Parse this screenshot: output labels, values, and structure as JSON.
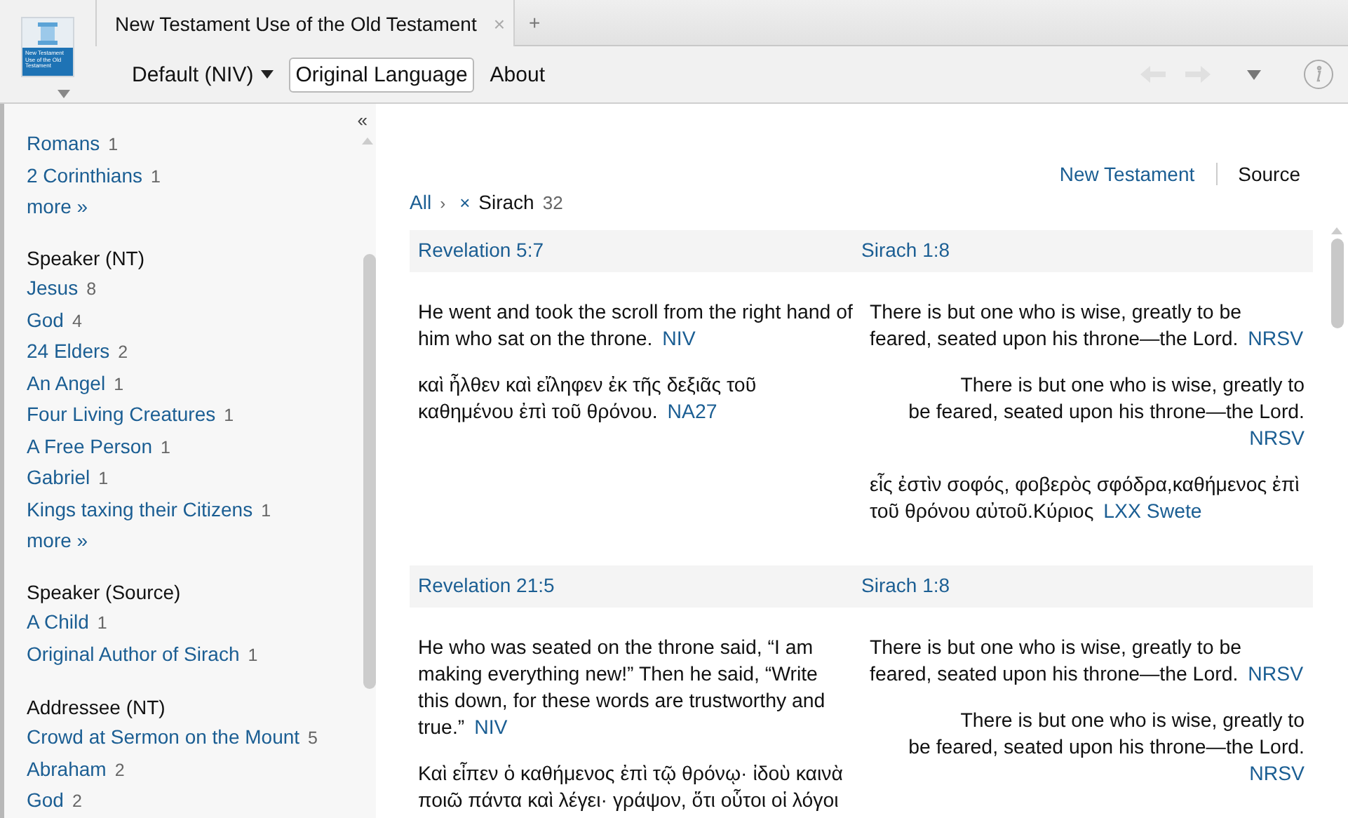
{
  "tab": {
    "title": "New Testament Use of the Old Testament",
    "close": "×",
    "add": "+"
  },
  "book_cover": {
    "title": "New Testament Use of the Old Testament"
  },
  "toolbar": {
    "items": [
      {
        "kind": "dropdown",
        "label": "Default (NIV)"
      },
      {
        "kind": "button",
        "label": "Original Language"
      },
      {
        "kind": "link",
        "label": "About"
      }
    ],
    "back_disabled": true,
    "forward_disabled": true
  },
  "sidebar": {
    "collapse": "«",
    "groups": [
      {
        "items": [
          {
            "label": "Romans",
            "count": "1"
          },
          {
            "label": "2 Corinthians",
            "count": "1"
          }
        ],
        "more": "more »"
      },
      {
        "heading": "Speaker (NT)",
        "items": [
          {
            "label": "Jesus",
            "count": "8"
          },
          {
            "label": "God",
            "count": "4"
          },
          {
            "label": "24 Elders",
            "count": "2"
          },
          {
            "label": "An Angel",
            "count": "1"
          },
          {
            "label": "Four Living Creatures",
            "count": "1"
          },
          {
            "label": "A Free Person",
            "count": "1"
          },
          {
            "label": "Gabriel",
            "count": "1"
          },
          {
            "label": "Kings taxing their Citizens",
            "count": "1"
          }
        ],
        "more": "more »"
      },
      {
        "heading": "Speaker (Source)",
        "items": [
          {
            "label": "A Child",
            "count": "1"
          },
          {
            "label": "Original Author of Sirach",
            "count": "1"
          }
        ]
      },
      {
        "heading": "Addressee (NT)",
        "items": [
          {
            "label": "Crowd at Sermon on the Mount",
            "count": "5"
          },
          {
            "label": "Abraham",
            "count": "2"
          },
          {
            "label": "God",
            "count": "2"
          }
        ]
      }
    ]
  },
  "main": {
    "view_toggle": [
      {
        "label": "New Testament",
        "selected": false
      },
      {
        "label": "Source",
        "selected": true
      }
    ],
    "breadcrumb": {
      "root": "All",
      "separator": "›",
      "remove": "×",
      "filter": "Sirach",
      "count": "32"
    },
    "rows": [
      {
        "nt_reference": "Revelation 5:7",
        "source_reference": "Sirach 1:8",
        "nt_passages": [
          {
            "text": "He went and took the scroll from the right hand of him who sat on the throne.",
            "version": "NIV",
            "indented": false
          },
          {
            "text": "καὶ ἦλθεν καὶ εἴληφεν ἐκ τῆς δεξιᾶς τοῦ καθημένου ἐπὶ τοῦ θρόνου.",
            "version": "NA27",
            "indented": false
          }
        ],
        "source_passages": [
          {
            "text": "There is but one who is wise, greatly to be feared, seated upon his throne—the Lord.",
            "version": "NRSV",
            "indented": false
          },
          {
            "text": "There is but one who is wise, greatly to be feared, seated upon his throne—the Lord.",
            "version": "NRSV",
            "indented": true
          },
          {
            "text": "εἷς ἐστὶν σοφός, φοβερὸς σφόδρα,καθήμενος ἐπὶ τοῦ θρόνου αὐτοῦ.Κύριος",
            "version": "LXX Swete",
            "indented": false
          }
        ]
      },
      {
        "nt_reference": "Revelation 21:5",
        "source_reference": "Sirach 1:8",
        "nt_passages": [
          {
            "text": "He who was seated on the throne said, “I am making everything new!” Then he said, “Write this down, for these words are trustworthy and true.”",
            "version": "NIV",
            "indented": false
          },
          {
            "text": "Καὶ εἶπεν ὁ καθήμενος ἐπὶ τῷ θρόνῳ· ἰδοὺ καινὰ ποιῶ πάντα καὶ λέγει· γράψον, ὅτι οὗτοι οἱ λόγοι",
            "indented": false
          }
        ],
        "source_passages": [
          {
            "text": "There is but one who is wise, greatly to be feared, seated upon his throne—the Lord.",
            "version": "NRSV",
            "indented": false
          },
          {
            "text": "There is but one who is wise, greatly to be feared, seated upon his throne—the Lord.",
            "version": "NRSV",
            "indented": true
          }
        ]
      }
    ]
  }
}
